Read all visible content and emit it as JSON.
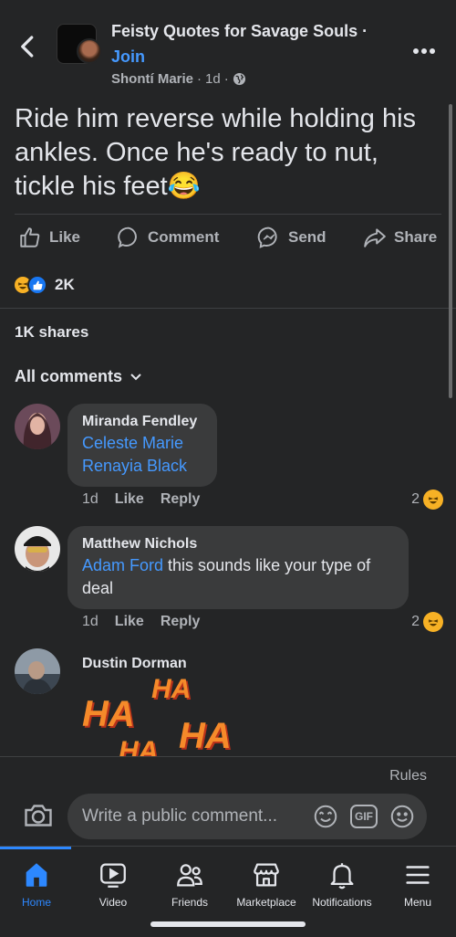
{
  "header": {
    "group_name": "Feisty Quotes for Savage Souls ·",
    "join_label": "Join",
    "author": "Shontí Marie",
    "time": "1d",
    "privacy_icon": "globe-icon"
  },
  "post": {
    "text": "Ride him reverse while holding his ankles. Once he's ready to nut, tickle his feet",
    "emoji": "😂"
  },
  "actions": {
    "like": "Like",
    "comment": "Comment",
    "send": "Send",
    "share": "Share"
  },
  "reactions": {
    "count": "2K",
    "types": [
      "haha",
      "like"
    ]
  },
  "shares_text": "1K shares",
  "comments_filter": "All comments",
  "comments": [
    {
      "name": "Miranda Fendley",
      "mention1": "Celeste Marie",
      "mention2": "Renayia Black",
      "time": "1d",
      "like": "Like",
      "reply": "Reply",
      "reaction_count": "2"
    },
    {
      "name": "Matthew Nichols",
      "mention": "Adam Ford",
      "text": " this sounds like your type of deal",
      "time": "1d",
      "like": "Like",
      "reply": "Reply",
      "reaction_count": "2"
    },
    {
      "name": "Dustin Dorman",
      "gif_word": "HA"
    }
  ],
  "composer": {
    "rules": "Rules",
    "placeholder": "Write a public comment...",
    "gif_label": "GIF"
  },
  "tabs": [
    {
      "label": "Home",
      "icon": "home-icon"
    },
    {
      "label": "Video",
      "icon": "video-icon"
    },
    {
      "label": "Friends",
      "icon": "friends-icon"
    },
    {
      "label": "Marketplace",
      "icon": "marketplace-icon"
    },
    {
      "label": "Notifications",
      "icon": "bell-icon"
    },
    {
      "label": "Menu",
      "icon": "menu-icon"
    }
  ],
  "colors": {
    "background": "#242526",
    "bubble": "#3a3b3c",
    "link": "#4599ff",
    "accent": "#2d88ff",
    "secondary_text": "#b0b3b8"
  }
}
